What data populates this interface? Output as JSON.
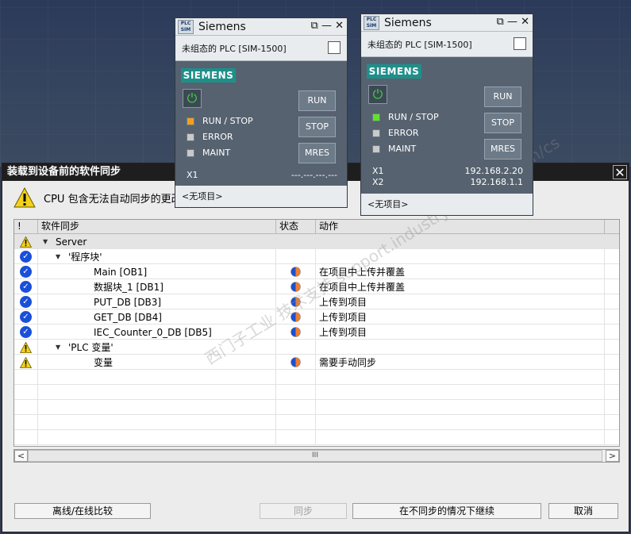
{
  "dialog": {
    "title": "装载到设备前的软件同步",
    "close_glyph": "✕",
    "warning_text": "CPU 包含无法自动同步的更改",
    "watermark": "西门子工业  技术支持  support.industry.siemens.com/cs"
  },
  "table": {
    "headers": [
      "!",
      "软件同步",
      "状态",
      "动作"
    ],
    "rows": [
      {
        "icon": "warning",
        "indent": 0,
        "expand": "▼",
        "name": "Server",
        "state": "",
        "action": ""
      },
      {
        "icon": "check",
        "indent": 1,
        "expand": "▼",
        "name": "'程序块'",
        "state": "",
        "action": ""
      },
      {
        "icon": "check",
        "indent": 2,
        "expand": "",
        "name": "Main [OB1]",
        "state": "half",
        "action": "在项目中上传并覆盖"
      },
      {
        "icon": "check",
        "indent": 2,
        "expand": "",
        "name": "数据块_1 [DB1]",
        "state": "half",
        "action": "在项目中上传并覆盖"
      },
      {
        "icon": "check",
        "indent": 2,
        "expand": "",
        "name": "PUT_DB [DB3]",
        "state": "orange",
        "action": "上传到项目"
      },
      {
        "icon": "check",
        "indent": 2,
        "expand": "",
        "name": "GET_DB [DB4]",
        "state": "orange",
        "action": "上传到项目"
      },
      {
        "icon": "check",
        "indent": 2,
        "expand": "",
        "name": "IEC_Counter_0_DB [DB5]",
        "state": "orange",
        "action": "上传到项目"
      },
      {
        "icon": "warning",
        "indent": 1,
        "expand": "▼",
        "name": "'PLC 变量'",
        "state": "",
        "action": ""
      },
      {
        "icon": "warning",
        "indent": 2,
        "expand": "",
        "name": "变量",
        "state": "half",
        "action": "需要手动同步"
      }
    ],
    "empty_rows": 5
  },
  "scrollbar": {
    "left": "<",
    "right": ">",
    "thumb_grip": "III"
  },
  "buttons": {
    "compare": "离线/在线比较",
    "sync": "同步",
    "continue": "在不同步的情况下继续",
    "cancel": "取消"
  },
  "sims": [
    {
      "logo": "PLC SIM",
      "title": "Siemens",
      "controls": "⧉ — ✕",
      "subtitle": "未组态的 PLC [SIM-1500]",
      "brand": "SIEMENS",
      "power": "⏻",
      "leds": [
        {
          "label": "RUN / STOP",
          "color": "#f0a020"
        },
        {
          "label": "ERROR",
          "color": "#c9c9c9"
        },
        {
          "label": "MAINT",
          "color": "#c9c9c9"
        }
      ],
      "buttons": [
        "RUN",
        "STOP",
        "MRES"
      ],
      "interfaces": [
        {
          "name": "X1",
          "address": "---.---.---.---"
        }
      ],
      "footer": "<无项目>"
    },
    {
      "logo": "PLC SIM",
      "title": "Siemens",
      "controls": "⧉ — ✕",
      "subtitle": "未组态的 PLC [SIM-1500]",
      "brand": "SIEMENS",
      "power": "⏻",
      "leds": [
        {
          "label": "RUN / STOP",
          "color": "#5fe22a"
        },
        {
          "label": "ERROR",
          "color": "#c9c9c9"
        },
        {
          "label": "MAINT",
          "color": "#c9c9c9"
        }
      ],
      "buttons": [
        "RUN",
        "STOP",
        "MRES"
      ],
      "interfaces": [
        {
          "name": "X1",
          "address": "192.168.2.20"
        },
        {
          "name": "X2",
          "address": "192.168.1.1"
        }
      ],
      "footer": "<无项目>"
    }
  ]
}
